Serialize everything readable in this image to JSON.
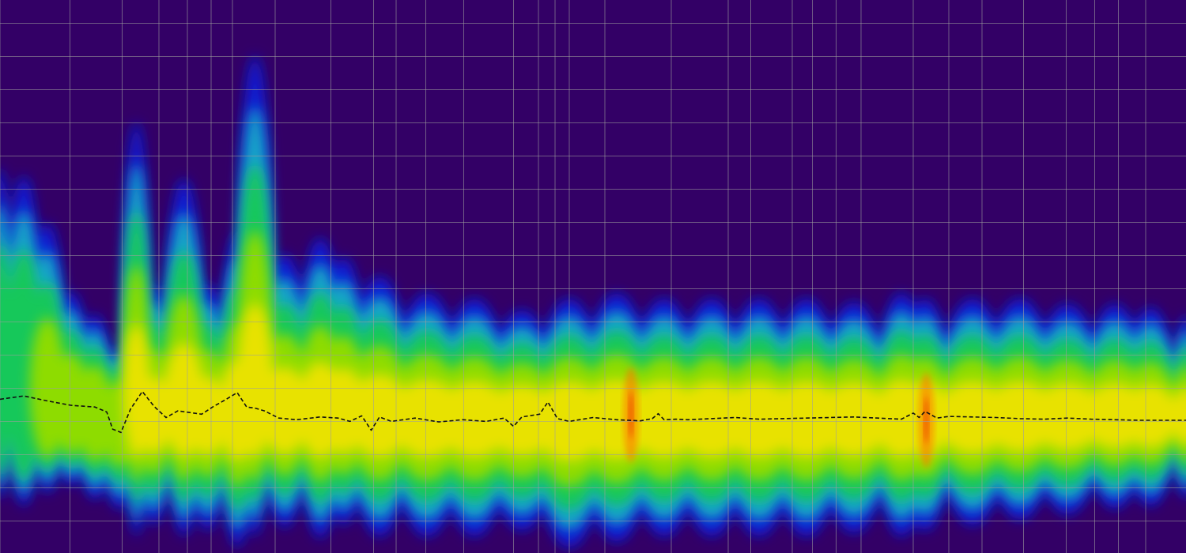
{
  "chart_data": {
    "type": "heatmap",
    "title": "",
    "xlabel": "",
    "ylabel": "",
    "grid": true,
    "background_color": "#330066",
    "grid_color": "#9e9e9e",
    "colormap": [
      "#330066",
      "#0a1fd6",
      "#12a6c8",
      "#16c85a",
      "#8edc05",
      "#e8e200",
      "#ff7a00",
      "#e80000"
    ],
    "x_domain": [
      0,
      100
    ],
    "y_domain": [
      0,
      100
    ],
    "vertical_grid_x": [
      0,
      5.9,
      10.3,
      13.4,
      15.8,
      17.8,
      19.6,
      23.2,
      27.9,
      31.5,
      33.4,
      35.9,
      39.1,
      43.3,
      45.4,
      46.8,
      48.0,
      51.0,
      56.6,
      61.4,
      63.3,
      66.8,
      68.5,
      70.5,
      72.6,
      77.0,
      80.0,
      82.8,
      86.3,
      89.9,
      92.3,
      94.3,
      96.6
    ],
    "horizontal_grid_y": [
      4.2,
      10.2,
      16.2,
      22.2,
      28.2,
      34.2,
      40.2,
      46.2,
      52.2,
      58.2,
      64.2,
      70.2,
      76.2,
      82.2,
      88.2,
      94.2
    ],
    "band": {
      "center_y": 76.0,
      "columns": [
        {
          "x": 0,
          "top": 0,
          "bottom": 100,
          "intensity": 0.45
        },
        {
          "x": 2,
          "top": 8,
          "bottom": 100,
          "intensity": 0.5
        },
        {
          "x": 4,
          "top": 25,
          "bottom": 95,
          "intensity": 0.55
        },
        {
          "x": 6,
          "top": 45,
          "bottom": 92,
          "intensity": 0.6
        },
        {
          "x": 8,
          "top": 52,
          "bottom": 94,
          "intensity": 0.65
        },
        {
          "x": 10,
          "top": 60,
          "bottom": 95,
          "intensity": 0.7
        },
        {
          "x": 11.5,
          "top": 22,
          "bottom": 97,
          "intensity": 0.85
        },
        {
          "x": 13,
          "top": 50,
          "bottom": 96,
          "intensity": 0.8
        },
        {
          "x": 15.5,
          "top": 30,
          "bottom": 98,
          "intensity": 0.8
        },
        {
          "x": 17.5,
          "top": 50,
          "bottom": 97,
          "intensity": 0.8
        },
        {
          "x": 20,
          "top": 42,
          "bottom": 99,
          "intensity": 0.85
        },
        {
          "x": 21.5,
          "top": 10,
          "bottom": 97,
          "intensity": 0.85
        },
        {
          "x": 24,
          "top": 45,
          "bottom": 96,
          "intensity": 0.82
        },
        {
          "x": 27,
          "top": 42,
          "bottom": 98,
          "intensity": 0.82
        },
        {
          "x": 29,
          "top": 45,
          "bottom": 96,
          "intensity": 0.8
        },
        {
          "x": 32,
          "top": 50,
          "bottom": 97,
          "intensity": 0.85
        },
        {
          "x": 36,
          "top": 53,
          "bottom": 97,
          "intensity": 0.9
        },
        {
          "x": 40,
          "top": 54,
          "bottom": 97,
          "intensity": 0.85
        },
        {
          "x": 44,
          "top": 55,
          "bottom": 97,
          "intensity": 0.8
        },
        {
          "x": 48,
          "top": 54,
          "bottom": 99,
          "intensity": 0.85
        },
        {
          "x": 52,
          "top": 53,
          "bottom": 98,
          "intensity": 0.9
        },
        {
          "x": 56,
          "top": 54,
          "bottom": 97,
          "intensity": 0.85
        },
        {
          "x": 60,
          "top": 54,
          "bottom": 97,
          "intensity": 0.85
        },
        {
          "x": 64,
          "top": 54,
          "bottom": 97,
          "intensity": 0.85
        },
        {
          "x": 68,
          "top": 54,
          "bottom": 97,
          "intensity": 0.85
        },
        {
          "x": 72,
          "top": 54,
          "bottom": 97,
          "intensity": 0.82
        },
        {
          "x": 76,
          "top": 53,
          "bottom": 97,
          "intensity": 0.85
        },
        {
          "x": 78,
          "top": 54,
          "bottom": 96,
          "intensity": 0.95
        },
        {
          "x": 82,
          "top": 54,
          "bottom": 95,
          "intensity": 0.85
        },
        {
          "x": 86,
          "top": 54,
          "bottom": 94,
          "intensity": 0.85
        },
        {
          "x": 90,
          "top": 55,
          "bottom": 93,
          "intensity": 0.85
        },
        {
          "x": 94,
          "top": 55,
          "bottom": 92,
          "intensity": 0.85
        },
        {
          "x": 97,
          "top": 55,
          "bottom": 92,
          "intensity": 0.82
        },
        {
          "x": 100,
          "top": 56,
          "bottom": 91,
          "intensity": 0.8
        }
      ],
      "hotspots": [
        {
          "x": 53.2,
          "y": 75,
          "intensity": 1.0
        },
        {
          "x": 78.1,
          "y": 76,
          "intensity": 1.0
        }
      ]
    },
    "series": [
      {
        "style": "dashed",
        "color": "#111111",
        "x": [
          0,
          2,
          4,
          6,
          8,
          9,
          9.5,
          10.2,
          11,
          12,
          13,
          14,
          15,
          16,
          17,
          18,
          19,
          20,
          20.8,
          21.5,
          22.3,
          23.5,
          25,
          27,
          28.5,
          29.5,
          30.5,
          31.3,
          32,
          33,
          35,
          37,
          39,
          41,
          42.5,
          43.3,
          44,
          45.5,
          46.2,
          47,
          48,
          50,
          52,
          54,
          55,
          55.5,
          56,
          57,
          58,
          59,
          60,
          62,
          64,
          66,
          68,
          70,
          72,
          74,
          76,
          77,
          77.5,
          78,
          79,
          80,
          82,
          84,
          86,
          88,
          90,
          92,
          94,
          96,
          98,
          100
        ],
        "y": [
          72.2,
          71.6,
          72.5,
          73.3,
          73.6,
          74.5,
          77.6,
          78.2,
          74.0,
          70.8,
          73.5,
          75.5,
          74.3,
          74.6,
          74.9,
          73.5,
          72.3,
          71.0,
          73.6,
          73.8,
          74.3,
          75.6,
          75.9,
          75.4,
          75.6,
          76.2,
          75.2,
          77.8,
          75.4,
          76.2,
          75.6,
          76.3,
          75.9,
          76.2,
          75.6,
          77.1,
          75.4,
          74.9,
          72.7,
          75.7,
          76.2,
          75.5,
          75.9,
          76.1,
          75.7,
          74.8,
          75.9,
          75.8,
          75.9,
          75.8,
          75.7,
          75.5,
          75.8,
          75.7,
          75.6,
          75.5,
          75.4,
          75.6,
          75.8,
          74.7,
          75.5,
          74.4,
          75.6,
          75.3,
          75.4,
          75.5,
          75.7,
          75.8,
          75.6,
          75.8,
          75.9,
          76.0,
          76.0,
          76.0
        ]
      }
    ]
  }
}
